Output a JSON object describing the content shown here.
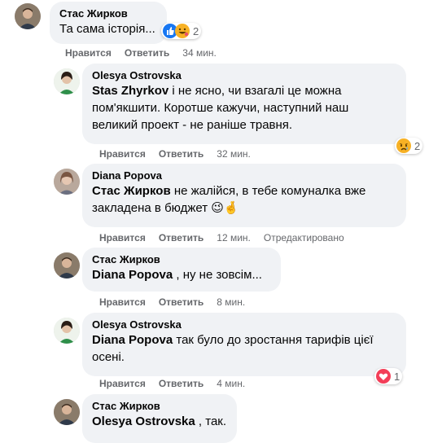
{
  "comments": [
    {
      "author": "Стас Жирков",
      "text": "Та сама історія...",
      "like_label": "Нравится",
      "reply_label": "Ответить",
      "time": "34 мин.",
      "reactions_count": "2",
      "reaction_icons": [
        "like-icon",
        "haha-icon"
      ]
    },
    {
      "author": "Olesya Ostrovska",
      "mention": "Stas Zhyrkov",
      "text": " і не ясно, чи взагалі це можна пом'якшити. Коротше кажучи, наступний наш великий проект - не раніше травня.",
      "like_label": "Нравится",
      "reply_label": "Ответить",
      "time": "32 мин.",
      "reactions_count": "2",
      "reaction_icons": [
        "sad-icon"
      ]
    },
    {
      "author": "Diana Popova",
      "mention": "Стас Жирков",
      "text": " не жалійся, в тебе комуналка вже закладена в бюджет 😉🤞",
      "like_label": "Нравится",
      "reply_label": "Ответить",
      "time": "12 мин.",
      "edited_label": "Отредактировано"
    },
    {
      "author": "Стас Жирков",
      "mention": "Diana Popova",
      "text": " , ну не зовсім...",
      "like_label": "Нравится",
      "reply_label": "Ответить",
      "time": "8 мин."
    },
    {
      "author": "Olesya Ostrovska",
      "mention": "Diana Popova",
      "text": " так було до зростання тарифів цієї осені.",
      "like_label": "Нравится",
      "reply_label": "Ответить",
      "time": "4 мин.",
      "reactions_count": "1",
      "reaction_icons": [
        "love-icon"
      ]
    },
    {
      "author": "Стас Жирков",
      "mention": "Olesya Ostrovska",
      "text": " , так."
    }
  ],
  "colors": {
    "bubble": "#f0f2f5",
    "secondary_text": "#65676b",
    "like_blue": "#1877f2",
    "love_red": "#f33e58",
    "emoji_yellow": "#f7b125"
  }
}
